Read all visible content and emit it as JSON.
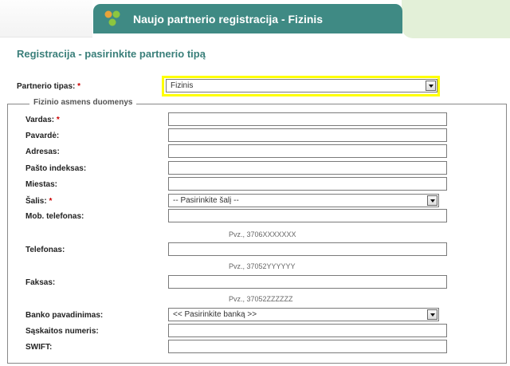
{
  "header": {
    "title": "Naujo partnerio registracija - Fizinis",
    "logo": "partner-logo-icon"
  },
  "page": {
    "title": "Registracija - pasirinkite partnerio tipą"
  },
  "partner_type": {
    "label": "Partnerio tipas:",
    "required_mark": "*",
    "selected": "Fizinis"
  },
  "fieldset": {
    "legend": "Fizinio asmens duomenys",
    "fields": {
      "vardas": {
        "label": "Vardas:",
        "required_mark": "*",
        "value": ""
      },
      "pavarde": {
        "label": "Pavardė:",
        "value": ""
      },
      "adresas": {
        "label": "Adresas:",
        "value": ""
      },
      "pasto_indeksas": {
        "label": "Pašto indeksas:",
        "value": ""
      },
      "miestas": {
        "label": "Miestas:",
        "value": ""
      },
      "salis": {
        "label": "Šalis:",
        "required_mark": "*",
        "selected": "-- Pasirinkite šalį --"
      },
      "mob_telefonas": {
        "label": "Mob. telefonas:",
        "value": "",
        "hint": "Pvz., 3706XXXXXXX"
      },
      "telefonas": {
        "label": "Telefonas:",
        "value": "",
        "hint": "Pvz., 37052YYYYYY"
      },
      "faksas": {
        "label": "Faksas:",
        "value": "",
        "hint": "Pvz., 37052ZZZZZZ"
      },
      "banko_pavadinimas": {
        "label": "Banko pavadinimas:",
        "selected": "<< Pasirinkite banką >>"
      },
      "saskaitos_numeris": {
        "label": "Sąskaitos numeris:",
        "value": ""
      },
      "swift": {
        "label": "SWIFT:",
        "value": ""
      }
    }
  },
  "colors": {
    "header_bg": "#3f8a84",
    "title": "#3a7f7a",
    "required": "#cc0000",
    "highlight": "#ffff00"
  }
}
